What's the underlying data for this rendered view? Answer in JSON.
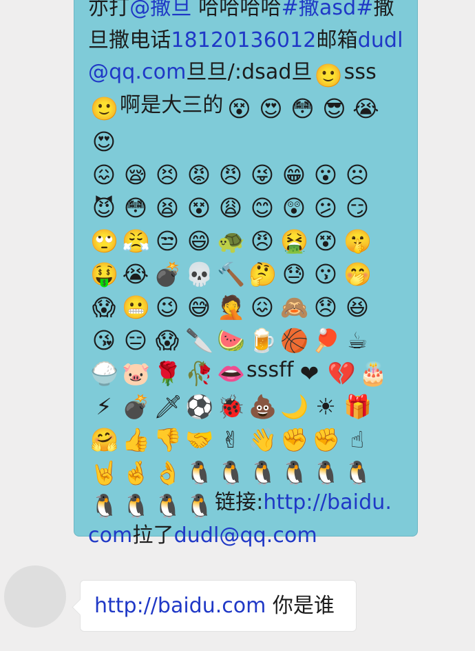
{
  "sent_message": {
    "text": {
      "l1a": "亦打",
      "l1b": "@撒旦",
      "l1c": " 哈哈哈哈",
      "l1d": "#撒asd#",
      "l1e": "撒",
      "l2a": "旦撒电话",
      "l2b": "18120136012",
      "l2c": "邮箱",
      "l2d": "dudl",
      "l3a": "@qq.com",
      "l3b": "旦旦/:dsad旦",
      "l3c": "sss",
      "l4a": "啊是大三的",
      "sssff": "sssff",
      "link_label": "链接:",
      "link_url1": "http://baidu.",
      "link_url2": "com",
      "pulled": "拉了",
      "email": "dudl@qq.com"
    },
    "emoji": {
      "r0": [
        "smile-face"
      ],
      "r1": [
        "dizzy-face",
        "heart-eyes",
        "frown-eyes",
        "cool-sunglasses",
        "crying-tears",
        "love-eyes"
      ],
      "r2": [
        "tongue-cross",
        "sleepy",
        "grimace-tears",
        "angry-red",
        "cursing",
        "wink-tongue",
        "big-grin",
        "surprised",
        "frown"
      ],
      "r3": [
        "devil-sunglasses",
        "blush-shy",
        "crying-open",
        "dizzy-sweat",
        "yawn",
        "happy-smile",
        "shocked",
        "confused",
        "sly"
      ],
      "r4": [
        "eye-roll",
        "furious",
        "smirk",
        "grinning",
        "turtle-helmet",
        "ninja-headband",
        "vomit",
        "dizzy-question",
        "shush"
      ],
      "r5": [
        "money-eyes",
        "big-cry",
        "bomb-face",
        "skull",
        "knock-hammer",
        "thinking",
        "sweating",
        "pucker",
        "giggle"
      ],
      "r6": [
        "scared",
        "grimace",
        "sideways",
        "sweat-awkward",
        "facepalm",
        "pain",
        "shy-covered",
        "sad",
        "laugh-squint"
      ],
      "r7": [
        "kiss-wink",
        "gloomy-lines",
        "scream",
        "cleaver",
        "watermelon",
        "beer-mug",
        "basketball",
        "ping-pong",
        "coffee"
      ],
      "r8": [
        "rice-bowl",
        "pig-face",
        "rose",
        "wilted-rose",
        "lips"
      ],
      "r8b": [
        "heart",
        "broken-heart",
        "cake"
      ],
      "r9": [
        "lightning",
        "bomb",
        "dagger",
        "soccer-ball",
        "ladybug",
        "poop",
        "moon",
        "sun",
        "gift"
      ],
      "r10": [
        "green-hug",
        "thumbs-up",
        "thumbs-down",
        "handshake",
        "victory",
        "come-here",
        "fist-round",
        "fist",
        "point-up"
      ],
      "r11": [
        "rock-sign",
        "crossed-fingers",
        "ok-hand",
        "penguin-kiss",
        "penguin-love",
        "penguin-fly",
        "penguin-dance",
        "penguin-shout",
        "penguin-wave"
      ],
      "r12": [
        "penguin-stand",
        "penguin-bow",
        "penguin-hop",
        "penguin-key"
      ]
    },
    "glyphs": {
      "smile-face": "🙂",
      "dizzy-face": "😵",
      "heart-eyes": "😍",
      "frown-eyes": "😳",
      "cool-sunglasses": "😎",
      "crying-tears": "😭",
      "love-eyes": "😍",
      "tongue-cross": "😖",
      "sleepy": "😪",
      "grimace-tears": "😣",
      "angry-red": "😡",
      "cursing": "😠",
      "wink-tongue": "😜",
      "big-grin": "😁",
      "surprised": "😮",
      "frown": "☹",
      "devil-sunglasses": "😈",
      "blush-shy": "😳",
      "crying-open": "😫",
      "dizzy-sweat": "😵",
      "yawn": "😩",
      "happy-smile": "😊",
      "shocked": "😲",
      "confused": "😕",
      "sly": "😏",
      "eye-roll": "🙄",
      "furious": "😤",
      "smirk": "😒",
      "grinning": "😄",
      "turtle-helmet": "🐢",
      "ninja-headband": "😠",
      "vomit": "🤮",
      "dizzy-question": "😵",
      "shush": "🤫",
      "money-eyes": "🤑",
      "big-cry": "😭",
      "bomb-face": "💣",
      "skull": "💀",
      "knock-hammer": "🔨",
      "thinking": "🤔",
      "sweating": "😓",
      "pucker": "😗",
      "giggle": "🤭",
      "scared": "😱",
      "grimace": "😬",
      "sideways": "😉",
      "sweat-awkward": "😅",
      "facepalm": "🤦",
      "pain": "😖",
      "shy-covered": "🙈",
      "sad": "😞",
      "laugh-squint": "😆",
      "kiss-wink": "😘",
      "gloomy-lines": "😑",
      "scream": "😱",
      "cleaver": "🔪",
      "watermelon": "🍉",
      "beer-mug": "🍺",
      "basketball": "🏀",
      "ping-pong": "🏓",
      "coffee": "☕",
      "rice-bowl": "🍚",
      "pig-face": "🐷",
      "rose": "🌹",
      "wilted-rose": "🥀",
      "lips": "👄",
      "heart": "❤",
      "broken-heart": "💔",
      "cake": "🎂",
      "lightning": "⚡",
      "bomb": "💣",
      "dagger": "🗡",
      "soccer-ball": "⚽",
      "ladybug": "🐞",
      "poop": "💩",
      "moon": "🌙",
      "sun": "☀",
      "gift": "🎁",
      "green-hug": "🤗",
      "thumbs-up": "👍",
      "thumbs-down": "👎",
      "handshake": "🤝",
      "victory": "✌",
      "come-here": "👋",
      "fist-round": "✊",
      "fist": "✊",
      "point-up": "☝",
      "rock-sign": "🤘",
      "crossed-fingers": "🤞",
      "ok-hand": "👌",
      "penguin-kiss": "🐧",
      "penguin-love": "🐧",
      "penguin-fly": "🐧",
      "penguin-dance": "🐧",
      "penguin-shout": "🐧",
      "penguin-wave": "🐧",
      "penguin-stand": "🐧",
      "penguin-bow": "🐧",
      "penguin-hop": "🐧",
      "penguin-key": "🐧"
    }
  },
  "received_message": {
    "link": "http://baidu.com",
    "text": " 你是谁"
  },
  "colors": {
    "background": "#efeeee",
    "sent_bubble": "#7fcbd8",
    "link": "#1f38c6",
    "received_bubble": "#ffffff",
    "avatar": "#dedede"
  }
}
